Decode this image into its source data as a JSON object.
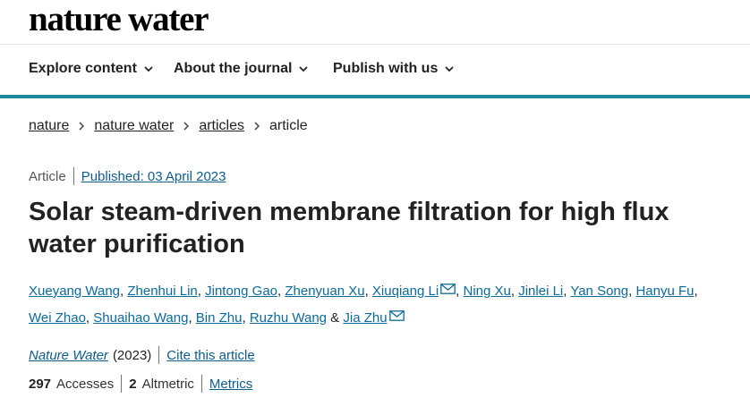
{
  "brand": {
    "logo_text": "nature water"
  },
  "nav": {
    "items": [
      {
        "label": "Explore content"
      },
      {
        "label": "About the journal"
      },
      {
        "label": "Publish with us"
      }
    ]
  },
  "breadcrumb": {
    "items": [
      "nature",
      "nature water",
      "articles"
    ],
    "current": "article"
  },
  "article": {
    "type": "Article",
    "published": "Published: 03 April 2023",
    "title": "Solar steam-driven membrane filtration for high flux water purification",
    "authors": [
      "Xueyang Wang",
      "Zhenhui Lin",
      "Jintong Gao",
      "Zhenyuan Xu",
      "Xiuqiang Li",
      "Ning Xu",
      "Jinlei Li",
      "Yan Song",
      "Hanyu Fu",
      "Wei Zhao",
      "Shuaihao Wang",
      "Bin Zhu",
      "Ruzhu Wang",
      "Jia Zhu"
    ],
    "author_joiner": "&",
    "journal": "Nature Water",
    "year": "(2023)",
    "cite_label": "Cite this article",
    "accesses_count": "297",
    "accesses_label": "Accesses",
    "altmetric_count": "2",
    "altmetric_label": "Altmetric",
    "metrics_label": "Metrics"
  },
  "colors": {
    "accent": "#1a8a9c",
    "link": "#0b5d8c"
  }
}
